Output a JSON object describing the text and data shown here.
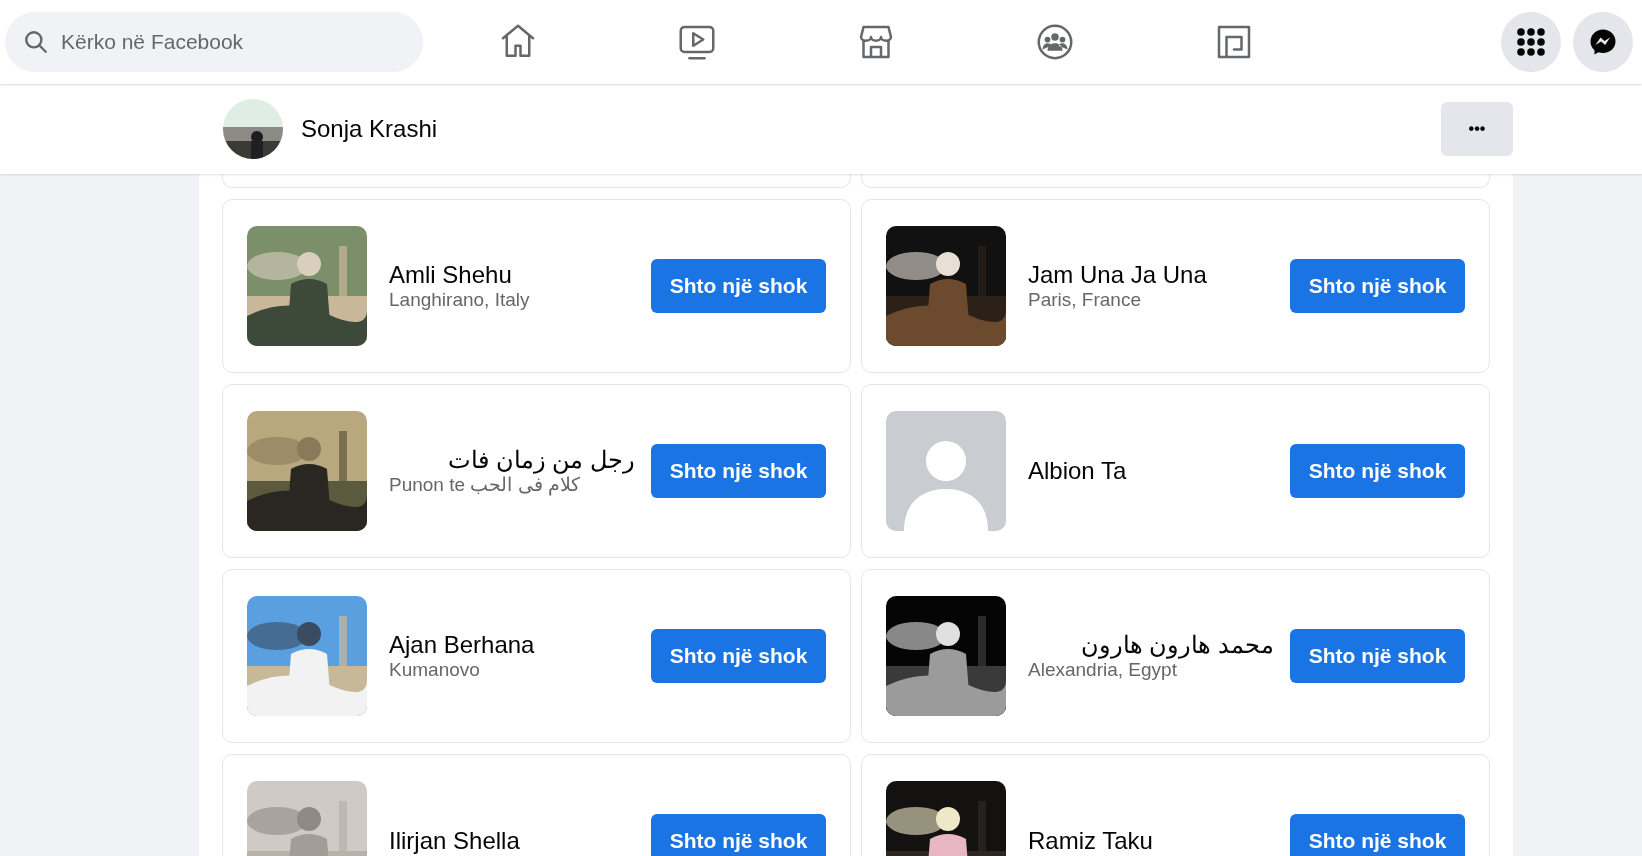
{
  "search": {
    "placeholder": "Kërko në Facebook"
  },
  "nav": [
    {
      "kind": "home"
    },
    {
      "kind": "watch"
    },
    {
      "kind": "marketplace"
    },
    {
      "kind": "groups"
    },
    {
      "kind": "gaming"
    }
  ],
  "profile": {
    "name": "Sonja Krashi",
    "more": "•••"
  },
  "cards": [
    {
      "name": "Amli Shehu",
      "subtitle": "Langhirano, Italy",
      "button": "Shto një shok"
    },
    {
      "name": "Jam Una Ja Una",
      "subtitle": "Paris, France",
      "button": "Shto një shok"
    },
    {
      "name": "رجل من زمان فات",
      "subtitle": "Punon te كلام فى الحب",
      "button": "Shto një shok"
    },
    {
      "name": "Albion Ta",
      "button": "Shto një shok",
      "photo": {
        "kind": "default_avatar"
      }
    },
    {
      "name": "Ajan Berhana",
      "subtitle": "Kumanovo",
      "button": "Shto një shok"
    },
    {
      "name": "محمد هارون هارون",
      "subtitle": "Alexandria, Egypt",
      "button": "Shto një shok"
    },
    {
      "name": "Ilirjan Shella",
      "button": "Shto një shok"
    },
    {
      "name": "Ramiz Taku",
      "button": "Shto një shok"
    }
  ]
}
